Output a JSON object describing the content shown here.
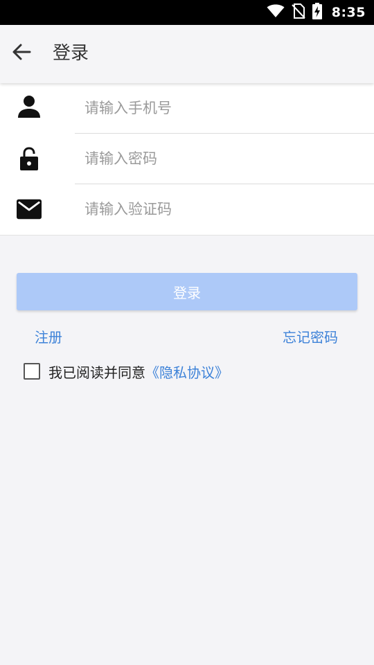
{
  "status_bar": {
    "time": "8:35",
    "icons": [
      "wifi-icon",
      "no-sim-icon",
      "battery-charging-icon"
    ]
  },
  "header": {
    "back_icon": "arrow-left-icon",
    "title": "登录"
  },
  "form": {
    "phone": {
      "icon": "user-icon",
      "placeholder": "请输入手机号",
      "value": ""
    },
    "password": {
      "icon": "lock-icon",
      "placeholder": "请输入密码",
      "value": ""
    },
    "code": {
      "icon": "mail-icon",
      "placeholder": "请输入验证码",
      "value": ""
    }
  },
  "actions": {
    "login_label": "登录",
    "register_label": "注册",
    "forgot_label": "忘记密码"
  },
  "agreement": {
    "checked": false,
    "text": "我已阅读并同意",
    "link_text": "《隐私协议》"
  },
  "colors": {
    "accent": "#3d82d8",
    "login_button_disabled": "#adc9f8",
    "background": "#f4f4f7"
  }
}
